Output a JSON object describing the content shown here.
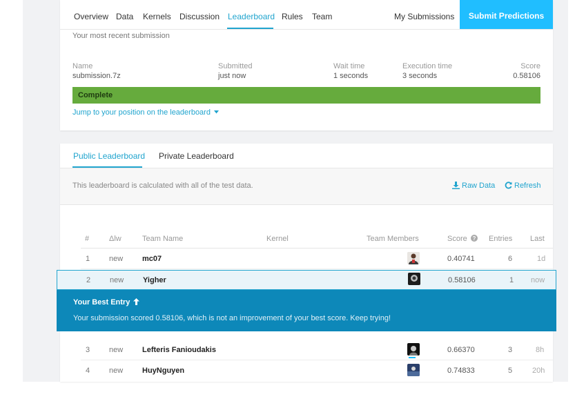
{
  "nav": {
    "tabs": [
      "Overview",
      "Data",
      "Kernels",
      "Discussion",
      "Leaderboard",
      "Rules",
      "Team"
    ],
    "active_tab": "Leaderboard",
    "my_submissions": "My Submissions",
    "submit_button": "Submit Predictions"
  },
  "recent": {
    "title": "Your most recent submission",
    "headers": {
      "name": "Name",
      "submitted": "Submitted",
      "wait": "Wait time",
      "execution": "Execution time",
      "score": "Score"
    },
    "values": {
      "name": "submission.7z",
      "submitted": "just now",
      "wait": "1 seconds",
      "execution": "3 seconds",
      "score": "0.58106"
    },
    "status": "Complete",
    "jump_link": "Jump to your position on the leaderboard",
    "status_color": "#66ab3d"
  },
  "leaderboard": {
    "tabs": [
      "Public Leaderboard",
      "Private Leaderboard"
    ],
    "active_tab": "Public Leaderboard",
    "note": "This leaderboard is calculated with all of the test data.",
    "raw_data": "Raw Data",
    "refresh": "Refresh",
    "columns": {
      "rank": "#",
      "delta": "Δlw",
      "team": "Team Name",
      "kernel": "Kernel",
      "members": "Team Members",
      "score": "Score",
      "entries": "Entries",
      "last": "Last"
    },
    "rows": [
      {
        "rank": "1",
        "delta": "new",
        "team": "mc07",
        "score": "0.40741",
        "entries": "6",
        "last": "1d"
      },
      {
        "rank": "2",
        "delta": "new",
        "team": "Yigher",
        "score": "0.58106",
        "entries": "1",
        "last": "now"
      },
      {
        "rank": "3",
        "delta": "new",
        "team": "Lefteris Fanioudakis",
        "score": "0.66370",
        "entries": "3",
        "last": "8h"
      },
      {
        "rank": "4",
        "delta": "new",
        "team": "HuyNguyen",
        "score": "0.74833",
        "entries": "5",
        "last": "20h"
      }
    ],
    "best_entry": {
      "title": "Your Best Entry",
      "message": "Your submission scored 0.58106, which is not an improvement of your best score. Keep trying!"
    },
    "accent_color": "#20a4ce"
  }
}
